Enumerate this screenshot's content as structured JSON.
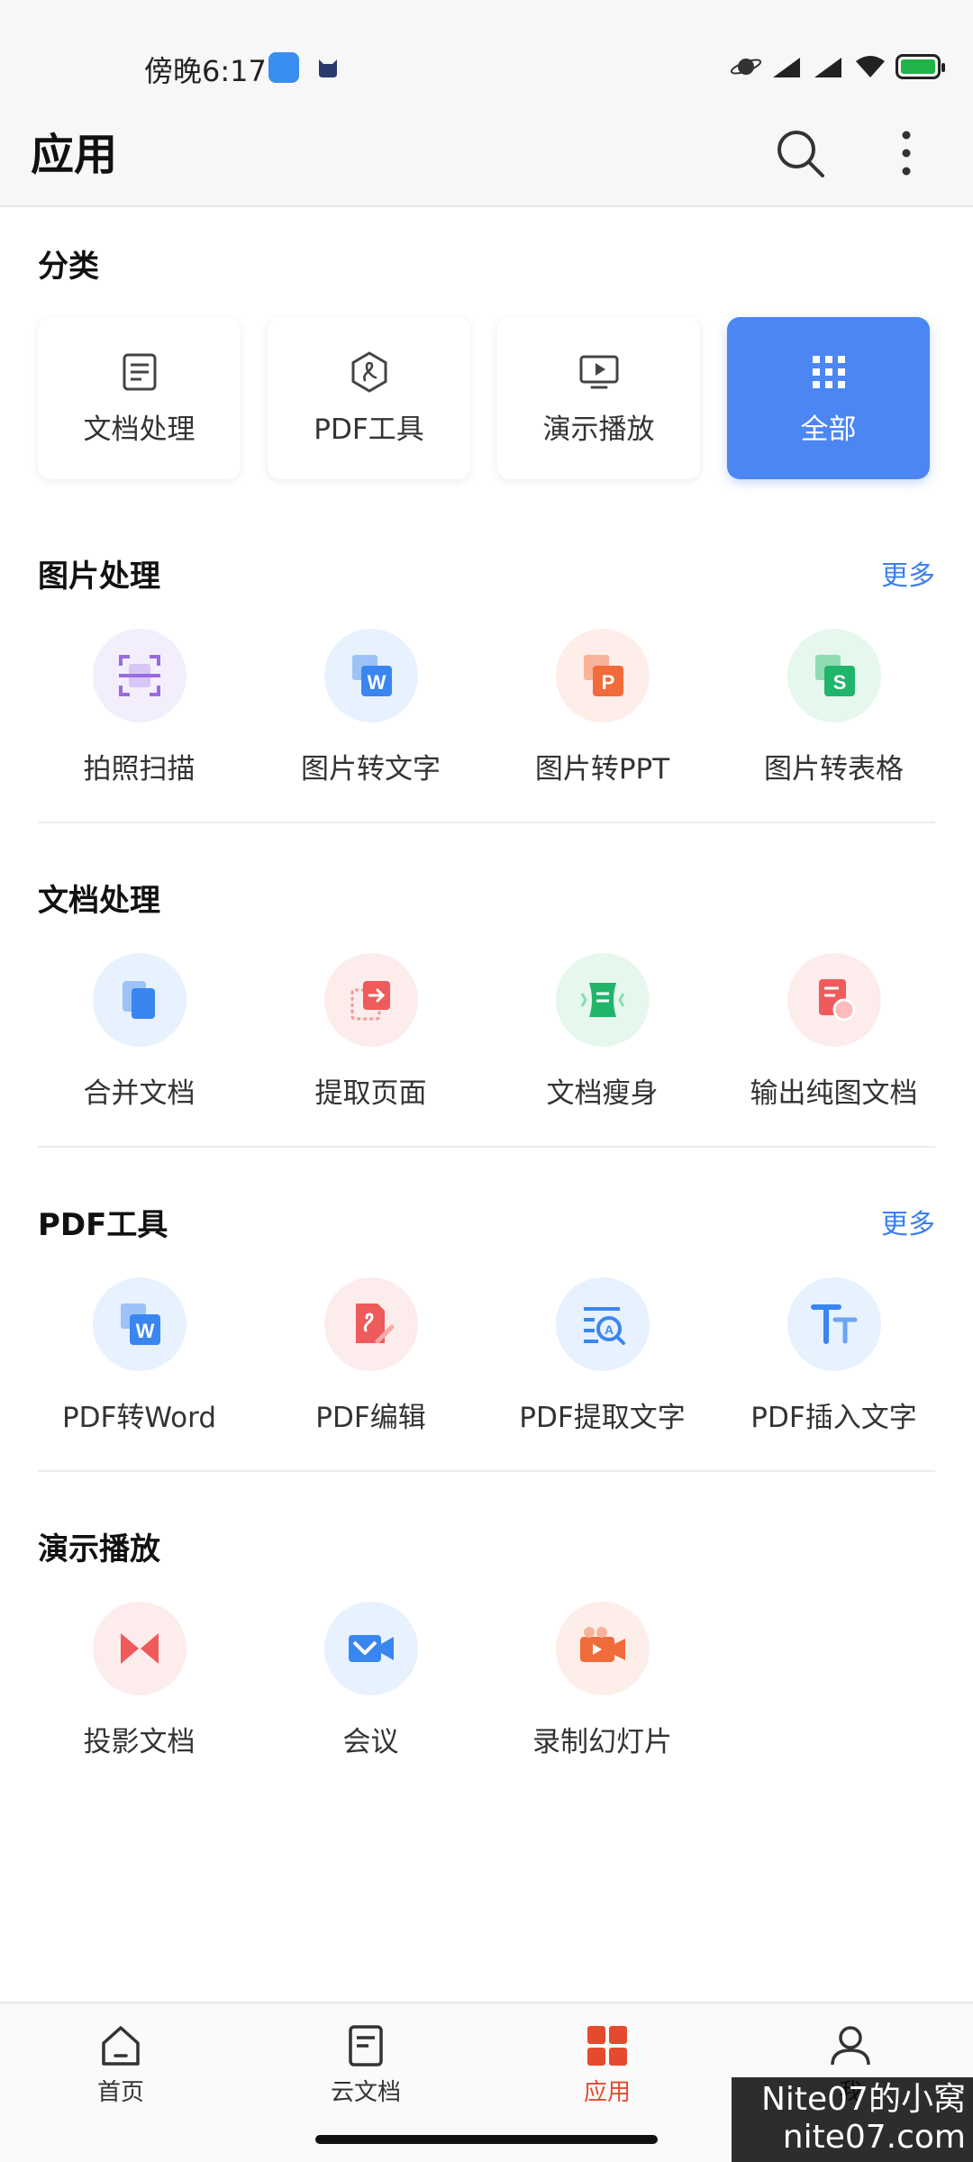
{
  "status_bar": {
    "time": "傍晚6:17"
  },
  "header": {
    "title": "应用",
    "search_icon": "search-icon",
    "more_icon": "more-vertical-icon"
  },
  "category": {
    "title": "分类",
    "cards": [
      {
        "label": "文档处理",
        "icon": "document-icon",
        "active": false
      },
      {
        "label": "PDF工具",
        "icon": "pdf-icon",
        "active": false
      },
      {
        "label": "演示播放",
        "icon": "presentation-icon",
        "active": false
      },
      {
        "label": "全部",
        "icon": "grid-icon",
        "active": true
      }
    ]
  },
  "image_processing": {
    "title": "图片处理",
    "more": "更多",
    "tools": [
      {
        "label": "拍照扫描",
        "icon": "scan-icon"
      },
      {
        "label": "图片转文字",
        "icon": "image-to-word-icon"
      },
      {
        "label": "图片转PPT",
        "icon": "image-to-ppt-icon"
      },
      {
        "label": "图片转表格",
        "icon": "image-to-sheet-icon"
      }
    ]
  },
  "doc_processing": {
    "title": "文档处理",
    "tools": [
      {
        "label": "合并文档",
        "icon": "merge-icon"
      },
      {
        "label": "提取页面",
        "icon": "extract-page-icon"
      },
      {
        "label": "文档瘦身",
        "icon": "slim-icon"
      },
      {
        "label": "输出纯图文档",
        "icon": "export-image-doc-icon"
      }
    ]
  },
  "pdf_tools": {
    "title": "PDF工具",
    "more": "更多",
    "tools": [
      {
        "label": "PDF转Word",
        "icon": "pdf-to-word-icon"
      },
      {
        "label": "PDF编辑",
        "icon": "pdf-edit-icon"
      },
      {
        "label": "PDF提取文字",
        "icon": "pdf-extract-text-icon"
      },
      {
        "label": "PDF插入文字",
        "icon": "pdf-insert-text-icon"
      }
    ]
  },
  "presentation": {
    "title": "演示播放",
    "tools": [
      {
        "label": "投影文档",
        "icon": "projection-icon"
      },
      {
        "label": "会议",
        "icon": "meeting-icon"
      },
      {
        "label": "录制幻灯片",
        "icon": "record-slides-icon"
      }
    ]
  },
  "bottom_nav": {
    "items": [
      {
        "label": "首页",
        "icon": "home-icon",
        "active": false
      },
      {
        "label": "云文档",
        "icon": "cloud-doc-icon",
        "active": false
      },
      {
        "label": "应用",
        "icon": "apps-icon",
        "active": true
      },
      {
        "label": "我",
        "icon": "profile-icon",
        "active": false
      }
    ]
  },
  "watermark": {
    "line1": "Nite07的小窝",
    "line2": "nite07.com"
  },
  "colors": {
    "accent_blue": "#4c86f3",
    "link_blue": "#3d7ff0",
    "active_red": "#e64a2e"
  }
}
